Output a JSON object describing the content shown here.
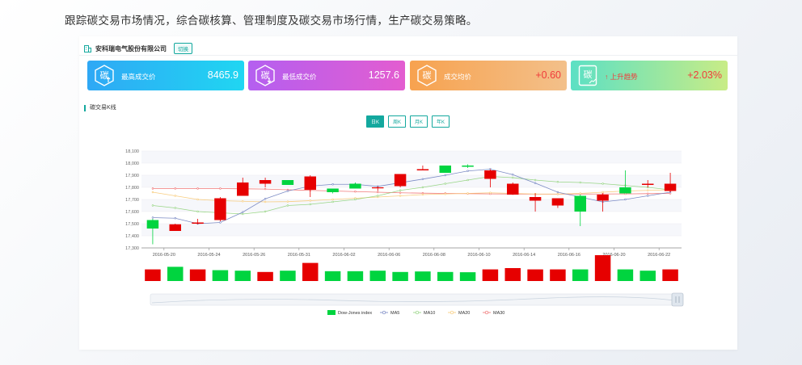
{
  "intro_text": "跟踪碳交易市场情况，综合碳核算、管理制度及碳交易市场行情，生产碳交易策略。",
  "company": {
    "name": "安科瑞电气股份有限公司",
    "switch_label": "切换"
  },
  "cards": [
    {
      "icon": "carbon-up-icon",
      "icon_char": "碳",
      "label": "最高成交价",
      "value": "8465.9"
    },
    {
      "icon": "carbon-down-icon",
      "icon_char": "碳",
      "label": "最低成交价",
      "value": "1257.6"
    },
    {
      "icon": "carbon-avg-icon",
      "icon_char": "碳",
      "label": "成交均价",
      "value": "+0.60"
    },
    {
      "icon": "carbon-trend-icon",
      "icon_char": "碳",
      "label": "上升趋势",
      "value": "+2.03%",
      "arrow": "↑"
    }
  ],
  "section_title": "碳交易K线",
  "periods": [
    "日K",
    "周K",
    "月K",
    "年K"
  ],
  "active_period": 0,
  "colors": {
    "up": "#e60000",
    "down": "#00d43f",
    "ma5": "#6f7fbf",
    "ma10": "#8fd17a",
    "ma20": "#f7c872",
    "ma30": "#ef6a6a",
    "accent": "#13a89e"
  },
  "chart_data": {
    "type": "candlestick",
    "ylim": [
      17300,
      18100
    ],
    "yticks": [
      "17,300",
      "17,400",
      "17,500",
      "17,600",
      "17,700",
      "17,800",
      "17,900",
      "18,000",
      "18,100"
    ],
    "x_tick_labels": [
      "2016-05-20",
      "2016-05-24",
      "2016-05-26",
      "2016-05-31",
      "2016-06-02",
      "2016-06-06",
      "2016-06-08",
      "2016-06-10",
      "2016-06-14",
      "2016-06-16",
      "2016-06-20",
      "2016-06-22"
    ],
    "x_tick_index": [
      1,
      3,
      5,
      7,
      9,
      11,
      13,
      15,
      17,
      19,
      21,
      23
    ],
    "candles": [
      {
        "o": 17530,
        "c": 17460,
        "h": 17540,
        "l": 17330
      },
      {
        "o": 17440,
        "c": 17495,
        "h": 17500,
        "l": 17440
      },
      {
        "o": 17500,
        "c": 17510,
        "h": 17540,
        "l": 17495
      },
      {
        "o": 17530,
        "c": 17710,
        "h": 17720,
        "l": 17520
      },
      {
        "o": 17730,
        "c": 17840,
        "h": 17880,
        "l": 17730
      },
      {
        "o": 17830,
        "c": 17860,
        "h": 17880,
        "l": 17800
      },
      {
        "o": 17860,
        "c": 17820,
        "h": 17860,
        "l": 17820
      },
      {
        "o": 17780,
        "c": 17890,
        "h": 17900,
        "l": 17720
      },
      {
        "o": 17790,
        "c": 17760,
        "h": 17790,
        "l": 17750
      },
      {
        "o": 17830,
        "c": 17790,
        "h": 17840,
        "l": 17790
      },
      {
        "o": 17800,
        "c": 17800,
        "h": 17810,
        "l": 17770
      },
      {
        "o": 17810,
        "c": 17910,
        "h": 17910,
        "l": 17800
      },
      {
        "o": 17940,
        "c": 17950,
        "h": 17980,
        "l": 17940
      },
      {
        "o": 17980,
        "c": 17920,
        "h": 17980,
        "l": 17920
      },
      {
        "o": 17980,
        "c": 17970,
        "h": 17990,
        "l": 17960
      },
      {
        "o": 17870,
        "c": 17940,
        "h": 17950,
        "l": 17800
      },
      {
        "o": 17740,
        "c": 17830,
        "h": 17840,
        "l": 17740
      },
      {
        "o": 17690,
        "c": 17720,
        "h": 17750,
        "l": 17600
      },
      {
        "o": 17650,
        "c": 17710,
        "h": 17710,
        "l": 17630
      },
      {
        "o": 17730,
        "c": 17600,
        "h": 17740,
        "l": 17480
      },
      {
        "o": 17690,
        "c": 17740,
        "h": 17750,
        "l": 17600
      },
      {
        "o": 17800,
        "c": 17750,
        "h": 17940,
        "l": 17750
      },
      {
        "o": 17820,
        "c": 17830,
        "h": 17860,
        "l": 17800
      },
      {
        "o": 17770,
        "c": 17830,
        "h": 17920,
        "l": 17760
      }
    ],
    "ma5": [
      17550,
      17545,
      17500,
      17510,
      17595,
      17705,
      17770,
      17810,
      17825,
      17825,
      17808,
      17838,
      17868,
      17900,
      17935,
      17950,
      17905,
      17835,
      17760,
      17720,
      17680,
      17700,
      17730,
      17760
    ],
    "ma10": [
      17650,
      17630,
      17600,
      17590,
      17580,
      17600,
      17650,
      17660,
      17680,
      17700,
      17730,
      17775,
      17800,
      17830,
      17860,
      17890,
      17880,
      17860,
      17845,
      17840,
      17830,
      17815,
      17800,
      17780
    ],
    "ma20": [
      17760,
      17730,
      17700,
      17690,
      17685,
      17680,
      17682,
      17690,
      17700,
      17710,
      17720,
      17730,
      17740,
      17745,
      17750,
      17755,
      17750,
      17745,
      17745,
      17750,
      17760,
      17770,
      17775,
      17780
    ],
    "ma30": [
      17790,
      17790,
      17790,
      17790,
      17788,
      17786,
      17780,
      17775,
      17770,
      17765,
      17760,
      17755,
      17752,
      17750,
      17748,
      17746,
      17745,
      17744,
      17744,
      17745,
      17745,
      17746,
      17748,
      17750
    ],
    "volume_up": [
      true,
      false,
      true,
      false,
      false,
      true,
      false,
      true,
      false,
      false,
      false,
      false,
      false,
      false,
      false,
      true,
      true,
      true,
      true,
      false,
      true,
      false,
      false,
      true
    ],
    "volume": [
      0.45,
      0.55,
      0.45,
      0.42,
      0.4,
      0.35,
      0.4,
      0.7,
      0.38,
      0.38,
      0.4,
      0.35,
      0.37,
      0.35,
      0.34,
      0.45,
      0.5,
      0.45,
      0.45,
      0.45,
      1.0,
      0.45,
      0.4,
      0.45
    ],
    "legend": [
      "Dow-Jones index",
      "MA5",
      "MA10",
      "MA20",
      "MA30"
    ]
  }
}
